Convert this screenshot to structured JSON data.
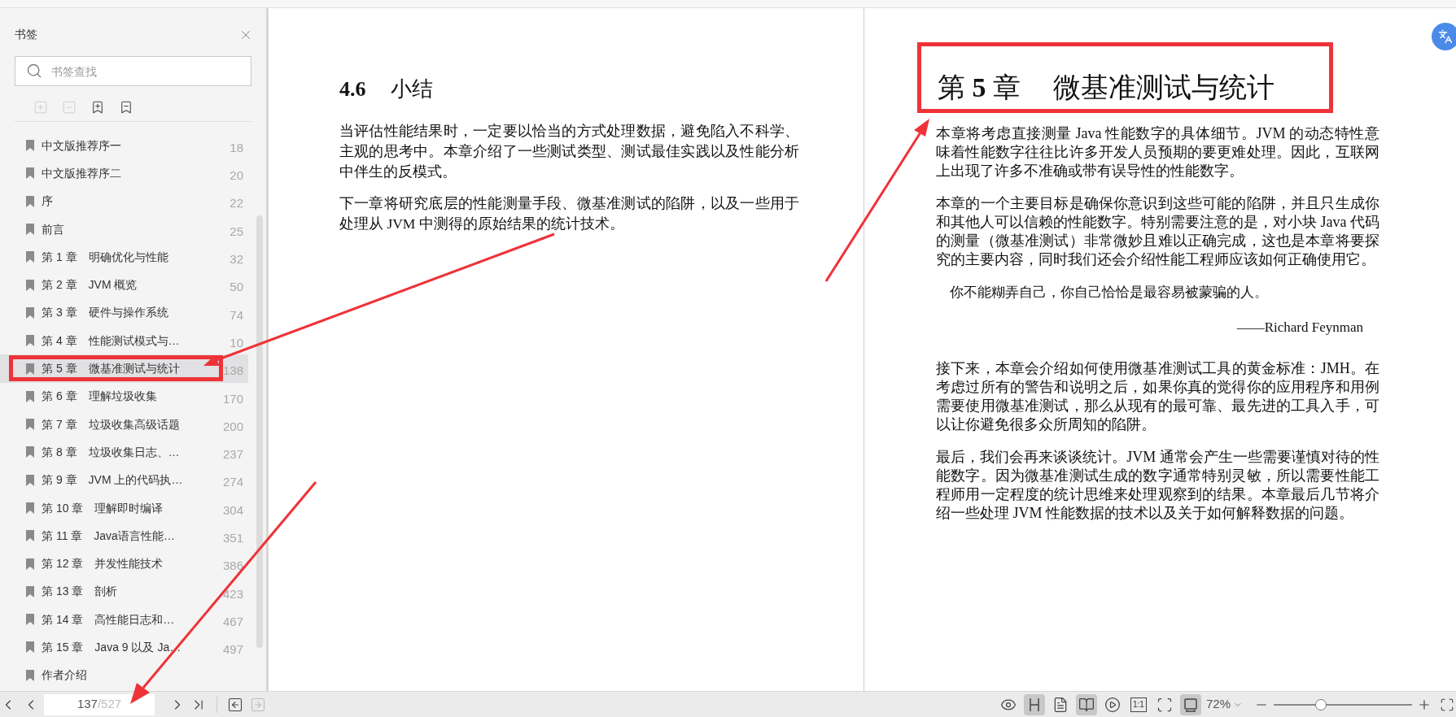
{
  "sidebar": {
    "title": "书签",
    "search": {
      "placeholder": "书签查找"
    },
    "tools": [
      {
        "kind": "add-sub",
        "disabled": true
      },
      {
        "kind": "remove-sub",
        "disabled": true
      },
      {
        "kind": "add-bookmark",
        "disabled": false
      },
      {
        "kind": "remove-bookmark",
        "disabled": false
      }
    ],
    "items": [
      {
        "label": "中文版推荐序一",
        "page": "18",
        "selected": false
      },
      {
        "label": "中文版推荐序二",
        "page": "20",
        "selected": false
      },
      {
        "label": "序",
        "page": "22",
        "selected": false
      },
      {
        "label": "前言",
        "page": "25",
        "selected": false
      },
      {
        "label": "第 1 章　明确优化与性能",
        "page": "32",
        "selected": false
      },
      {
        "label": "第 2 章　JVM 概览",
        "page": "50",
        "selected": false
      },
      {
        "label": "第 3 章　硬件与操作系统",
        "page": "74",
        "selected": false
      },
      {
        "label": "第 4 章　性能测试模式与…",
        "page": "10",
        "selected": false
      },
      {
        "label": "第 5 章　微基准测试与统计",
        "page": "138",
        "selected": true
      },
      {
        "label": "第 6 章　理解垃圾收集",
        "page": "170",
        "selected": false
      },
      {
        "label": "第 7 章　垃圾收集高级话题",
        "page": "200",
        "selected": false
      },
      {
        "label": "第 8 章　垃圾收集日志、…",
        "page": "237",
        "selected": false
      },
      {
        "label": "第 9 章　JVM 上的代码执…",
        "page": "274",
        "selected": false
      },
      {
        "label": "第 10 章　理解即时编译",
        "page": "304",
        "selected": false
      },
      {
        "label": "第 11 章　Java语言性能…",
        "page": "351",
        "selected": false
      },
      {
        "label": "第 12 章　并发性能技术",
        "page": "386",
        "selected": false
      },
      {
        "label": "第 13 章　剖析",
        "page": "423",
        "selected": false
      },
      {
        "label": "第 14 章　高性能日志和…",
        "page": "467",
        "selected": false
      },
      {
        "label": "第 15 章　Java 9 以及 Ja…",
        "page": "497",
        "selected": false
      },
      {
        "label": "作者介绍",
        "selected": false
      }
    ]
  },
  "left_page": {
    "heading_number": "4.6",
    "heading_title": "小结",
    "paragraphs": [
      "当评估性能结果时，一定要以恰当的方式处理数据，避免陷入不科学、主观的思考中。本章介绍了一些测试类型、测试最佳实践以及性能分析中伴生的反模式。",
      "下一章将研究底层的性能测量手段、微基准测试的陷阱，以及一些用于处理从 JVM 中测得的原始结果的统计技术。"
    ]
  },
  "right_page": {
    "heading_number": "第 **5** 章",
    "heading_title": "微基准测试与统计",
    "paragraphs": [
      {
        "kind": "body",
        "text": "本章将考虑直接测量 Java 性能数字的具体细节。JVM 的动态特性意味着性能数字往往比许多开发人员预期的要更难处理。因此，互联网上出现了许多不准确或带有误导性的性能数字。"
      },
      {
        "kind": "body",
        "text": "本章的一个主要目标是确保你意识到这些可能的陷阱，并且只生成你和其他人可以信赖的性能数字。特别需要注意的是，对小块 Java 代码的测量（微基准测试）非常微妙且难以正确完成，这也是本章将要探究的主要内容，同时我们还会介绍性能工程师应该如何正确使用它。"
      },
      {
        "kind": "quote",
        "text": "你不能糊弄自己，你自己恰恰是最容易被蒙骗的人。"
      },
      {
        "kind": "attribution",
        "text": "——Richard Feynman"
      },
      {
        "kind": "body",
        "text": "接下来，本章会介绍如何使用微基准测试工具的黄金标准：JMH。在考虑过所有的警告和说明之后，如果你真的觉得你的应用程序和用例需要使用微基准测试，那么从现有的最可靠、最先进的工具入手，可以让你避免很多众所周知的陷阱。"
      },
      {
        "kind": "body",
        "text": "最后，我们会再来谈谈统计。JVM 通常会产生一些需要谨慎对待的性能数字。因为微基准测试生成的数字通常特别灵敏，所以需要性能工程师用一定程度的统计思维来处理观察到的结果。本章最后几节将介绍一些处理 JVM 性能数据的技术以及关于如何解释数据的问题。"
      }
    ]
  },
  "bottom_bar": {
    "page_current": "137",
    "page_total": "/527",
    "history": [
      {
        "kind": "back",
        "disabled": false
      },
      {
        "kind": "forward",
        "disabled": true
      }
    ],
    "views": [
      {
        "kind": "eye",
        "selected": false
      },
      {
        "kind": "continuous",
        "selected": true
      },
      {
        "kind": "single",
        "selected": false
      },
      {
        "kind": "double",
        "selected": true
      },
      {
        "kind": "play",
        "selected": false
      },
      {
        "kind": "actual",
        "label": "1:1",
        "selected": false
      },
      {
        "kind": "fit-page",
        "selected": false
      },
      {
        "kind": "fit-width",
        "selected": true
      }
    ],
    "zoom": "72%",
    "zoom_slider": {
      "level": 0.34
    }
  }
}
